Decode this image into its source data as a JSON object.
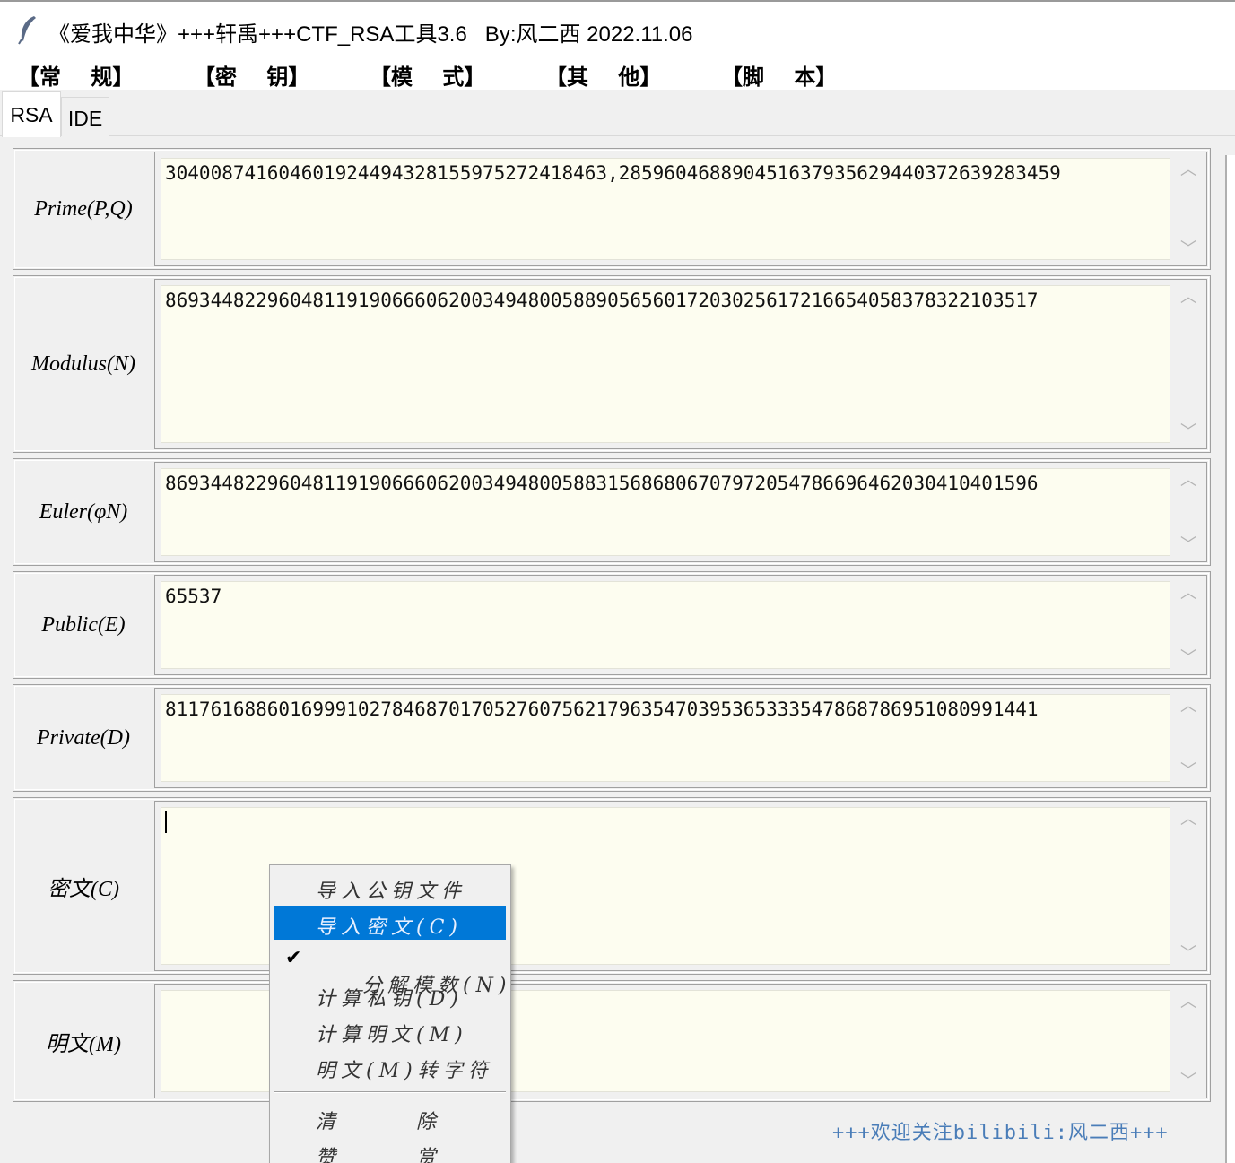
{
  "window": {
    "title": "《爱我中华》+++轩禹+++CTF_RSA工具3.6   By:风二西 2022.11.06",
    "icon": "feather-icon"
  },
  "menubar": {
    "items": [
      {
        "label": "【常    规】"
      },
      {
        "label": "【密    钥】"
      },
      {
        "label": "【模    式】"
      },
      {
        "label": "【其    他】"
      },
      {
        "label": "【脚    本】"
      }
    ]
  },
  "tabs": [
    {
      "label": "RSA",
      "active": true
    },
    {
      "label": "IDE",
      "active": false
    }
  ],
  "fields": {
    "prime": {
      "label": "Prime(P,Q)",
      "value": "304008741604601924494328155975272418463,285960468890451637935629440372639283459"
    },
    "modulus": {
      "label": "Modulus(N)",
      "value": "86934482296048119190666062003494800588905656017203025617216654058378322103517"
    },
    "euler": {
      "label": "Euler(φN)",
      "value": "86934482296048119190666062003494800588315686806707972054786696462030410401596"
    },
    "public": {
      "label": "Public(E)",
      "value": "65537"
    },
    "private": {
      "label": "Private(D)",
      "value": "81176168860169991027846870170527607562179635470395365333547868786951080991441"
    },
    "cipher": {
      "label": "密文(C)",
      "value": ""
    },
    "plain": {
      "label": "明文(M)",
      "value": ""
    }
  },
  "scroll_glyphs": {
    "up": "︿",
    "down": "﹀"
  },
  "context_menu": {
    "items": [
      {
        "label": "导入公钥文件",
        "highlighted": false,
        "checked": false
      },
      {
        "label": "导入密文(C)",
        "highlighted": true,
        "checked": false
      },
      {
        "label": "分解模数(N)",
        "highlighted": false,
        "checked": true
      },
      {
        "label": "计算私钥(D)",
        "highlighted": false,
        "checked": false
      },
      {
        "label": "计算明文(M)",
        "highlighted": false,
        "checked": false
      },
      {
        "label": "明文(M)转字符",
        "highlighted": false,
        "checked": false
      }
    ],
    "check_glyph": "✔",
    "clear": {
      "left": "清",
      "right": "除"
    },
    "reward": {
      "left": "赞",
      "right": "赏"
    }
  },
  "footer": {
    "text": "+++欢迎关注bilibili:风二西+++"
  },
  "colors": {
    "highlight": "#0078d7",
    "textarea_bg": "#fdfdf0",
    "footer": "#4a7db8"
  }
}
